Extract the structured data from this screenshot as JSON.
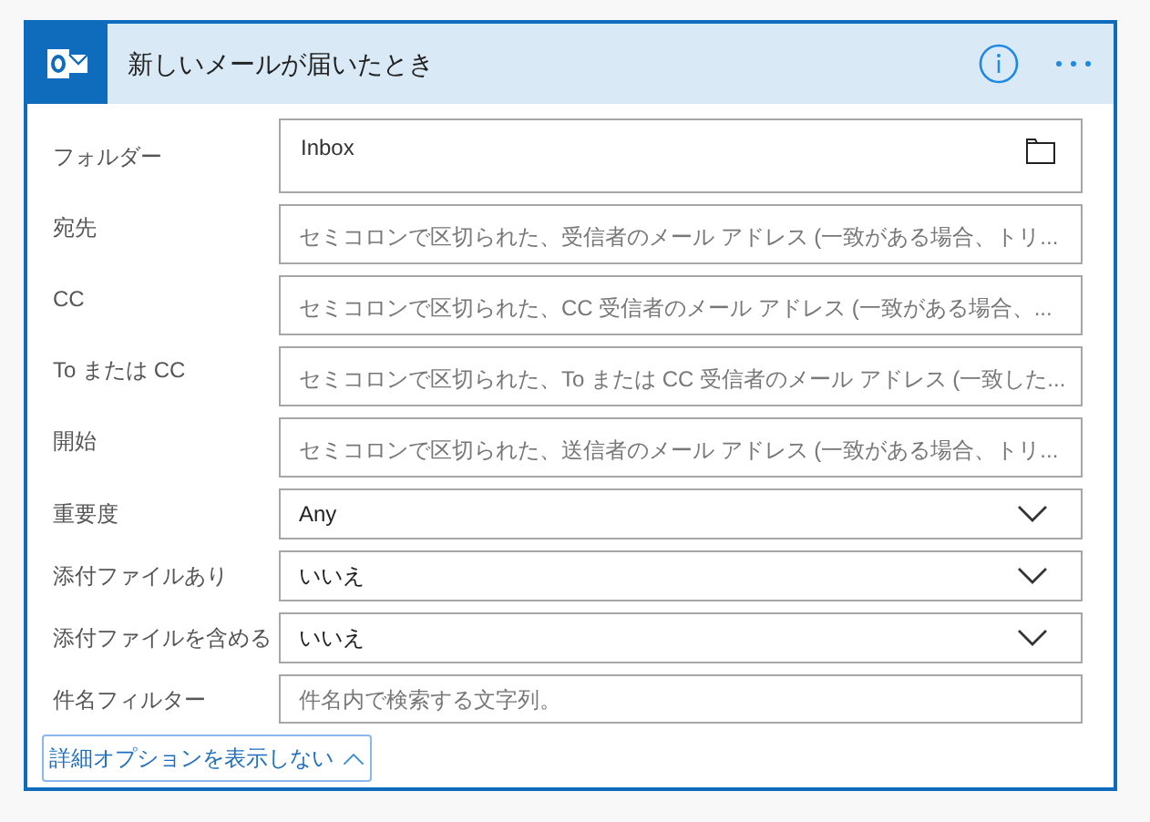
{
  "header": {
    "title": "新しいメールが届いたとき"
  },
  "fields": [
    {
      "kind": "folder",
      "label": "フォルダー",
      "value": "Inbox"
    },
    {
      "kind": "text",
      "label": "宛先",
      "placeholder": "セミコロンで区切られた、受信者のメール アドレス (一致がある場合、トリ..."
    },
    {
      "kind": "text",
      "label": "CC",
      "placeholder": "セミコロンで区切られた、CC 受信者のメール アドレス (一致がある場合、..."
    },
    {
      "kind": "text",
      "label": "To または CC",
      "placeholder": "セミコロンで区切られた、To または CC 受信者のメール アドレス (一致した..."
    },
    {
      "kind": "text",
      "label": "開始",
      "placeholder": "セミコロンで区切られた、送信者のメール アドレス (一致がある場合、トリ..."
    },
    {
      "kind": "dropdown",
      "label": "重要度",
      "value": "Any"
    },
    {
      "kind": "dropdown",
      "label": "添付ファイルあり",
      "value": "いいえ"
    },
    {
      "kind": "dropdown",
      "label": "添付ファイルを含める",
      "value": "いいえ"
    },
    {
      "kind": "short",
      "label": "件名フィルター",
      "placeholder": "件名内で検索する文字列。"
    }
  ],
  "toggle": {
    "label": "詳細オプションを表示しない",
    "expanded": true
  }
}
